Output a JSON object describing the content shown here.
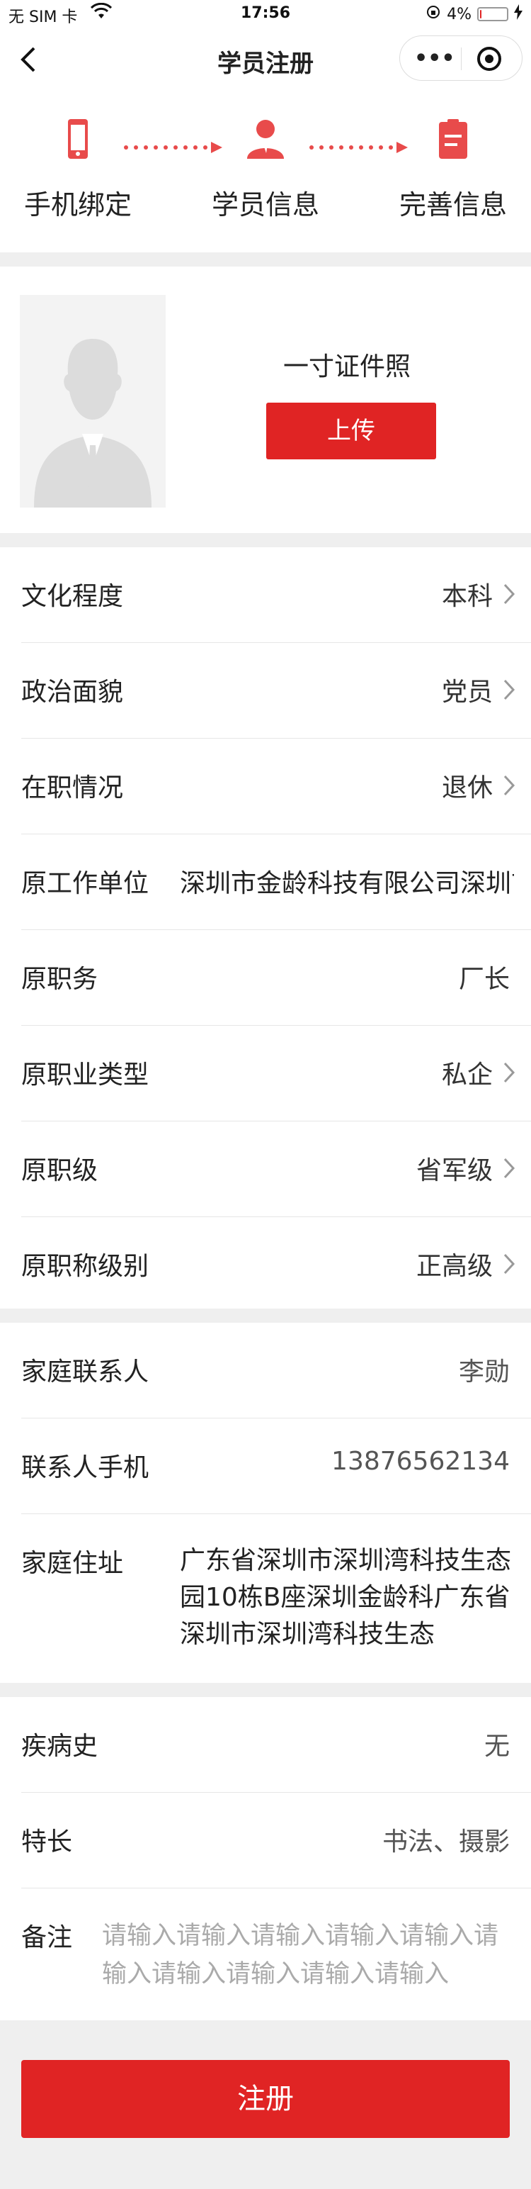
{
  "status": {
    "carrier": "无 SIM 卡",
    "time": "17:56",
    "battery": "4%",
    "battery_level": 0.04
  },
  "nav": {
    "title": "学员注册",
    "more": "•••"
  },
  "steps": [
    {
      "label": "手机绑定",
      "icon": "phone-icon"
    },
    {
      "label": "学员信息",
      "icon": "user-icon"
    },
    {
      "label": "完善信息",
      "icon": "clipboard-icon"
    }
  ],
  "photo": {
    "title": "一寸证件照",
    "upload_label": "上传"
  },
  "info": [
    {
      "key": "文化程度",
      "value": "本科"
    },
    {
      "key": "政治面貌",
      "value": "党员"
    },
    {
      "key": "在职情况",
      "value": "退休"
    },
    {
      "key": "原工作单位",
      "value": "深圳市金龄科技有限公司深圳市金龄科技有限公司"
    },
    {
      "key": "原职务",
      "value": "厂长"
    },
    {
      "key": "原职业类型",
      "value": "私企"
    },
    {
      "key": "原职级",
      "value": "省军级"
    },
    {
      "key": "原职称级别",
      "value": "正高级"
    }
  ],
  "contact": [
    {
      "key": "家庭联系人",
      "value": "李勋"
    },
    {
      "key": "联系人手机",
      "value": "13876562134"
    },
    {
      "key": "家庭住址",
      "value": "广东省深圳市深圳湾科技生态园10栋B座深圳金龄科广东省深圳市深圳湾科技生态"
    }
  ],
  "extra": [
    {
      "key": "疾病史",
      "value": "无"
    },
    {
      "key": "特长",
      "value": "书法、摄影"
    },
    {
      "key": "备注",
      "placeholder": "请输入请输入请输入请输入请输入请输入请输入请输入请输入请输入"
    }
  ],
  "submit_label": "注册",
  "colors": {
    "accent": "#e02424",
    "step_icon": "#e84b4b"
  }
}
